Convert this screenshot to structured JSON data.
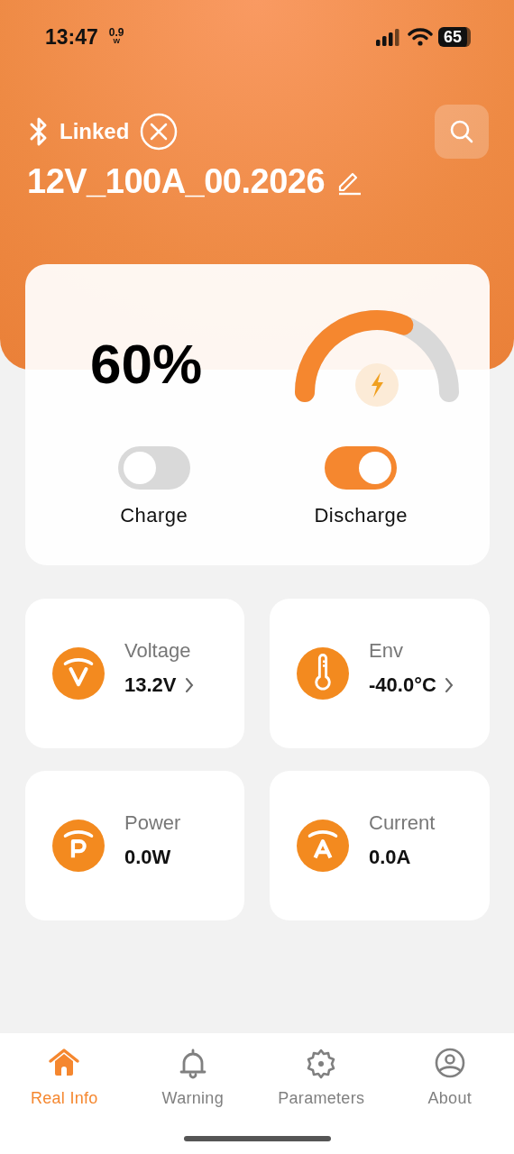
{
  "status_bar": {
    "time": "13:47",
    "power_value": "0.9",
    "power_unit": "W",
    "battery": "65"
  },
  "connection": {
    "label": "Linked",
    "connected": true
  },
  "device_name": "12V_100A_00.2026",
  "battery_card": {
    "percent": "60%",
    "switches": [
      {
        "label": "Charge",
        "on": false
      },
      {
        "label": "Discharge",
        "on": true
      }
    ]
  },
  "metrics": [
    {
      "kind": "voltage",
      "label": "Voltage",
      "value": "13.2V",
      "has_detail": true
    },
    {
      "kind": "temperature",
      "label": "Env",
      "value": "-40.0°C",
      "has_detail": true
    },
    {
      "kind": "power",
      "label": "Power",
      "value": "0.0W",
      "has_detail": false
    },
    {
      "kind": "current",
      "label": "Current",
      "value": "0.0A",
      "has_detail": false
    }
  ],
  "tabs": [
    {
      "kind": "home",
      "label": "Real Info",
      "selected": true
    },
    {
      "kind": "bell",
      "label": "Warning",
      "selected": false
    },
    {
      "kind": "gear",
      "label": "Parameters",
      "selected": false
    },
    {
      "kind": "person",
      "label": "About",
      "selected": false
    }
  ]
}
